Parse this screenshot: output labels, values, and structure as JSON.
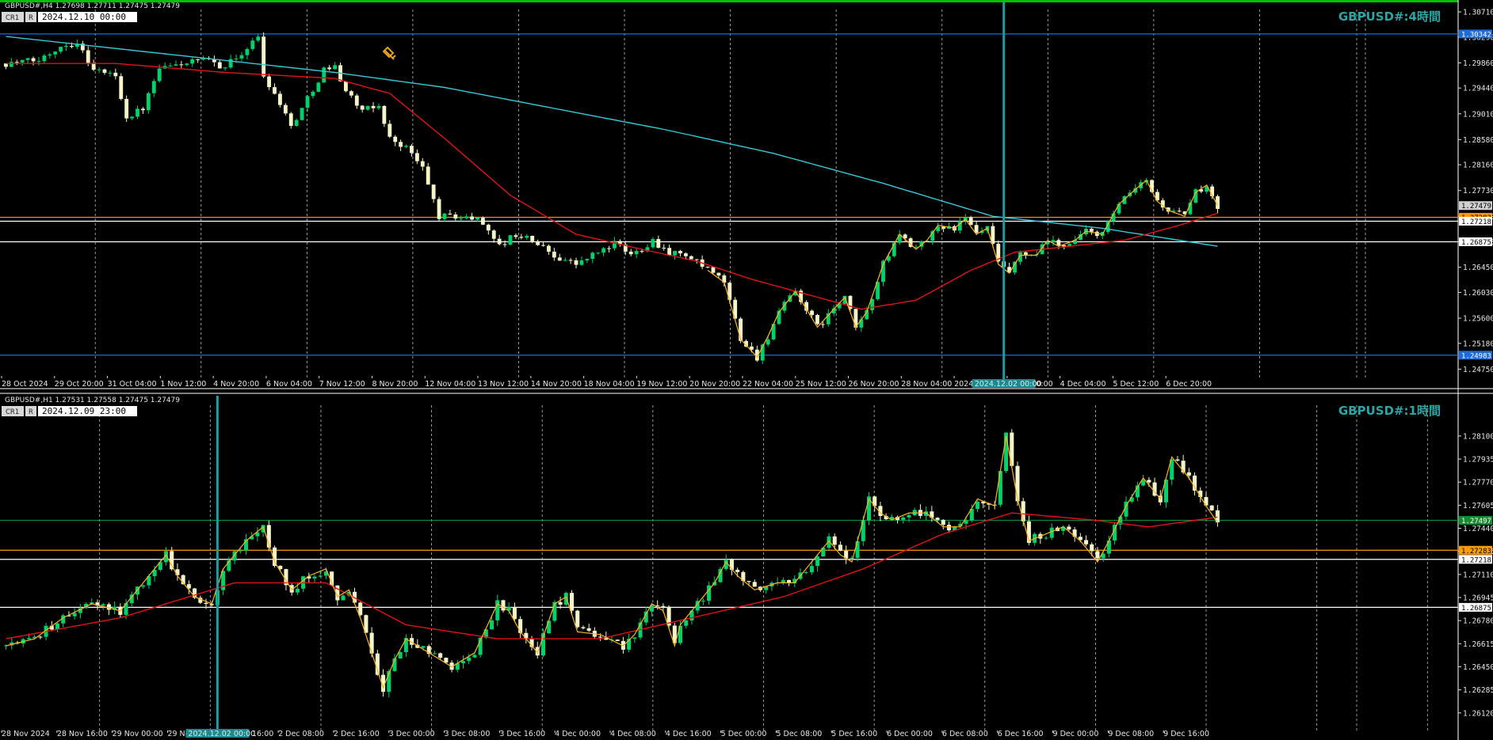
{
  "colors": {
    "bg": "#000000",
    "bull_candle": "#00d26a",
    "bear_candle": "#f5f5c8",
    "ma_fast": "#e01414",
    "ma_slow": "#35c8d8",
    "zigzag": "#ffb020",
    "level_orange": "#ff9c00",
    "level_white": "#ffffff",
    "level_blue": "#1e6bd6",
    "level_green": "#0f8f2f",
    "top_border": "#00c000",
    "cursor_line": "#1a9ea6",
    "title": "#2aa6a6"
  },
  "chart_data": [
    {
      "type": "candlestick",
      "header": "GBPUSD#,H4  1.27698 1.27711 1.27475 1.27479",
      "title": "GBPUSD#:4時間",
      "toolbar": {
        "label": "CR1",
        "r": "R",
        "datetime": "2024.12.10 00:00"
      },
      "ylim": [
        1.2465,
        1.3075
      ],
      "y_ticks": [
        "1.30710",
        "1.30290",
        "1.29860",
        "1.29440",
        "1.29010",
        "1.28580",
        "1.28160",
        "1.27730",
        "1.27300",
        "1.26875",
        "1.26450",
        "1.26030",
        "1.25600",
        "1.25180",
        "1.24750"
      ],
      "x_labels": [
        "28 Oct 2024",
        "29 Oct 20:00",
        "31 Oct 04:00",
        "1 Nov 12:00",
        "4 Nov 20:00",
        "6 Nov 04:00",
        "7 Nov 12:00",
        "8 Nov 20:00",
        "12 Nov 04:00",
        "13 Nov 12:00",
        "14 Nov 20:00",
        "18 Nov 04:00",
        "19 Nov 12:00",
        "20 Nov 20:00",
        "22 Nov 04:00",
        "25 Nov 12:00",
        "26 Nov 20:00",
        "28 Nov 04:00",
        "2024.12.02 00:00",
        "2 Dec 20:00",
        "4 Dec 04:00",
        "5 Dec 12:00",
        "6 Dec 20:00"
      ],
      "cursor_label": "2024.12.02 00:00",
      "levels": [
        {
          "price": 1.30342,
          "label": "1.30342",
          "color": "blue"
        },
        {
          "price": 1.27479,
          "label": "1.27479",
          "color": "white_dim"
        },
        {
          "price": 1.27283,
          "label": "1.27283",
          "color": "orange"
        },
        {
          "price": 1.27218,
          "label": "1.27218",
          "color": "white"
        },
        {
          "price": 1.26875,
          "label": "1.26875",
          "color": "white"
        },
        {
          "price": 1.24983,
          "label": "1.24983",
          "color": "blue"
        }
      ],
      "current_price": "1.27479",
      "keypoints": [
        [
          0,
          1.2985
        ],
        [
          6,
          1.299
        ],
        [
          10,
          1.3015
        ],
        [
          13,
          1.302
        ],
        [
          16,
          1.2975
        ],
        [
          20,
          1.2965
        ],
        [
          22,
          1.2895
        ],
        [
          25,
          1.291
        ],
        [
          28,
          1.2975
        ],
        [
          32,
          1.2985
        ],
        [
          36,
          1.299
        ],
        [
          40,
          1.298
        ],
        [
          44,
          1.301
        ],
        [
          46,
          1.303
        ],
        [
          47,
          1.2965
        ],
        [
          50,
          1.292
        ],
        [
          52,
          1.288
        ],
        [
          54,
          1.291
        ],
        [
          58,
          1.2975
        ],
        [
          60,
          1.298
        ],
        [
          62,
          1.294
        ],
        [
          65,
          1.2905
        ],
        [
          68,
          1.2915
        ],
        [
          70,
          1.286
        ],
        [
          73,
          1.2845
        ],
        [
          76,
          1.281
        ],
        [
          79,
          1.273
        ],
        [
          82,
          1.273
        ],
        [
          86,
          1.2725
        ],
        [
          88,
          1.271
        ],
        [
          90,
          1.268
        ],
        [
          93,
          1.27
        ],
        [
          96,
          1.269
        ],
        [
          100,
          1.2665
        ],
        [
          104,
          1.265
        ],
        [
          107,
          1.2665
        ],
        [
          111,
          1.2685
        ],
        [
          114,
          1.2665
        ],
        [
          118,
          1.269
        ],
        [
          121,
          1.267
        ],
        [
          124,
          1.2665
        ],
        [
          128,
          1.264
        ],
        [
          131,
          1.262
        ],
        [
          134,
          1.2525
        ],
        [
          137,
          1.2495
        ],
        [
          139,
          1.253
        ],
        [
          141,
          1.257
        ],
        [
          144,
          1.2605
        ],
        [
          146,
          1.2575
        ],
        [
          148,
          1.2545
        ],
        [
          151,
          1.2575
        ],
        [
          153,
          1.2595
        ],
        [
          155,
          1.2545
        ],
        [
          157,
          1.257
        ],
        [
          160,
          1.265
        ],
        [
          163,
          1.27
        ],
        [
          166,
          1.2675
        ],
        [
          168,
          1.269
        ],
        [
          170,
          1.2715
        ],
        [
          173,
          1.271
        ],
        [
          175,
          1.2725
        ],
        [
          177,
          1.27
        ],
        [
          179,
          1.271
        ],
        [
          181,
          1.265
        ],
        [
          183,
          1.2635
        ],
        [
          185,
          1.2665
        ],
        [
          188,
          1.2665
        ],
        [
          190,
          1.269
        ],
        [
          192,
          1.268
        ],
        [
          195,
          1.269
        ],
        [
          197,
          1.2705
        ],
        [
          200,
          1.27
        ],
        [
          203,
          1.275
        ],
        [
          206,
          1.2775
        ],
        [
          208,
          1.279
        ],
        [
          210,
          1.2755
        ],
        [
          212,
          1.274
        ],
        [
          215,
          1.273
        ],
        [
          217,
          1.277
        ],
        [
          219,
          1.2782
        ],
        [
          221,
          1.2748
        ]
      ],
      "ma_fast": [
        [
          0,
          1.2985
        ],
        [
          20,
          1.2985
        ],
        [
          40,
          1.297
        ],
        [
          60,
          1.296
        ],
        [
          70,
          1.2935
        ],
        [
          80,
          1.286
        ],
        [
          92,
          1.2765
        ],
        [
          104,
          1.27
        ],
        [
          116,
          1.2675
        ],
        [
          126,
          1.2655
        ],
        [
          136,
          1.2625
        ],
        [
          146,
          1.26
        ],
        [
          156,
          1.2575
        ],
        [
          166,
          1.259
        ],
        [
          176,
          1.264
        ],
        [
          184,
          1.267
        ],
        [
          194,
          1.268
        ],
        [
          204,
          1.269
        ],
        [
          214,
          1.2715
        ],
        [
          221,
          1.2735
        ]
      ],
      "ma_slow": [
        [
          0,
          1.303
        ],
        [
          20,
          1.301
        ],
        [
          40,
          1.299
        ],
        [
          60,
          1.297
        ],
        [
          80,
          1.2945
        ],
        [
          100,
          1.291
        ],
        [
          120,
          1.2875
        ],
        [
          140,
          1.2835
        ],
        [
          160,
          1.2785
        ],
        [
          180,
          1.273
        ],
        [
          200,
          1.271
        ],
        [
          221,
          1.268
        ]
      ]
    },
    {
      "type": "candlestick",
      "header": "GBPUSD#,H1  1.27531 1.27558 1.27475 1.27479",
      "title": "GBPUSD#:1時間",
      "toolbar": {
        "label": "CR1",
        "r": "R",
        "datetime": "2024.12.09 23:00"
      },
      "ylim": [
        1.26,
        1.2832
      ],
      "y_ticks": [
        "1.28100",
        "1.27935",
        "1.27770",
        "1.27605",
        "1.27440",
        "1.27275",
        "1.27110",
        "1.26945",
        "1.26780",
        "1.26615",
        "1.26450",
        "1.26285",
        "1.26120"
      ],
      "x_labels": [
        "28 Nov 2024",
        "28 Nov 16:00",
        "29 Nov 00:00",
        "29 Nov 08:00",
        "29 Nov 16:00",
        "2 Dec 08:00",
        "2 Dec 16:00",
        "3 Dec 00:00",
        "3 Dec 08:00",
        "3 Dec 16:00",
        "4 Dec 00:00",
        "4 Dec 08:00",
        "4 Dec 16:00",
        "5 Dec 00:00",
        "5 Dec 08:00",
        "5 Dec 16:00",
        "6 Dec 00:00",
        "6 Dec 08:00",
        "6 Dec 16:00",
        "9 Dec 00:00",
        "9 Dec 08:00",
        "9 Dec 16:00"
      ],
      "cursor_label": "2024.12.02 00:00",
      "levels": [
        {
          "price": 1.27497,
          "label": "1.27497",
          "color": "green"
        },
        {
          "price": 1.27283,
          "label": "1.27283",
          "color": "orange"
        },
        {
          "price": 1.27218,
          "label": "1.27218",
          "color": "white"
        },
        {
          "price": 1.26875,
          "label": "1.26875",
          "color": "white"
        }
      ],
      "current_price": "1.27479",
      "keypoints": [
        [
          0,
          1.266
        ],
        [
          5,
          1.2665
        ],
        [
          10,
          1.268
        ],
        [
          15,
          1.269
        ],
        [
          20,
          1.2685
        ],
        [
          24,
          1.2705
        ],
        [
          28,
          1.2725
        ],
        [
          30,
          1.271
        ],
        [
          33,
          1.2695
        ],
        [
          36,
          1.269
        ],
        [
          38,
          1.2715
        ],
        [
          42,
          1.2735
        ],
        [
          45,
          1.2745
        ],
        [
          47,
          1.272
        ],
        [
          50,
          1.27
        ],
        [
          53,
          1.271
        ],
        [
          56,
          1.2715
        ],
        [
          58,
          1.2695
        ],
        [
          60,
          1.27
        ],
        [
          62,
          1.268
        ],
        [
          64,
          1.2655
        ],
        [
          66,
          1.263
        ],
        [
          68,
          1.265
        ],
        [
          70,
          1.2665
        ],
        [
          74,
          1.2655
        ],
        [
          78,
          1.2645
        ],
        [
          82,
          1.2655
        ],
        [
          86,
          1.269
        ],
        [
          88,
          1.2685
        ],
        [
          90,
          1.267
        ],
        [
          93,
          1.2655
        ],
        [
          96,
          1.269
        ],
        [
          98,
          1.2695
        ],
        [
          100,
          1.267
        ],
        [
          104,
          1.2668
        ],
        [
          108,
          1.266
        ],
        [
          110,
          1.2668
        ],
        [
          113,
          1.269
        ],
        [
          115,
          1.2685
        ],
        [
          117,
          1.266
        ],
        [
          118,
          1.2675
        ],
        [
          121,
          1.269
        ],
        [
          124,
          1.2705
        ],
        [
          126,
          1.272
        ],
        [
          128,
          1.271
        ],
        [
          131,
          1.27
        ],
        [
          135,
          1.2705
        ],
        [
          138,
          1.2705
        ],
        [
          141,
          1.272
        ],
        [
          144,
          1.2735
        ],
        [
          146,
          1.2725
        ],
        [
          148,
          1.272
        ],
        [
          151,
          1.2765
        ],
        [
          153,
          1.2755
        ],
        [
          155,
          1.275
        ],
        [
          158,
          1.2755
        ],
        [
          161,
          1.2755
        ],
        [
          164,
          1.2745
        ],
        [
          167,
          1.2745
        ],
        [
          170,
          1.2765
        ],
        [
          173,
          1.276
        ],
        [
          175,
          1.281
        ],
        [
          177,
          1.2765
        ],
        [
          179,
          1.2735
        ],
        [
          182,
          1.274
        ],
        [
          185,
          1.2745
        ],
        [
          188,
          1.2735
        ],
        [
          191,
          1.272
        ],
        [
          193,
          1.2735
        ],
        [
          196,
          1.276
        ],
        [
          199,
          1.278
        ],
        [
          202,
          1.2765
        ],
        [
          204,
          1.2795
        ],
        [
          207,
          1.278
        ],
        [
          210,
          1.276
        ],
        [
          212,
          1.2748
        ]
      ],
      "ma_fast": [
        [
          0,
          1.2665
        ],
        [
          20,
          1.268
        ],
        [
          40,
          1.2705
        ],
        [
          56,
          1.2705
        ],
        [
          70,
          1.2675
        ],
        [
          86,
          1.2665
        ],
        [
          104,
          1.2665
        ],
        [
          120,
          1.268
        ],
        [
          136,
          1.2695
        ],
        [
          150,
          1.2715
        ],
        [
          164,
          1.274
        ],
        [
          176,
          1.2755
        ],
        [
          190,
          1.275
        ],
        [
          200,
          1.2745
        ],
        [
          212,
          1.2752
        ]
      ],
      "zigzag": true
    }
  ]
}
